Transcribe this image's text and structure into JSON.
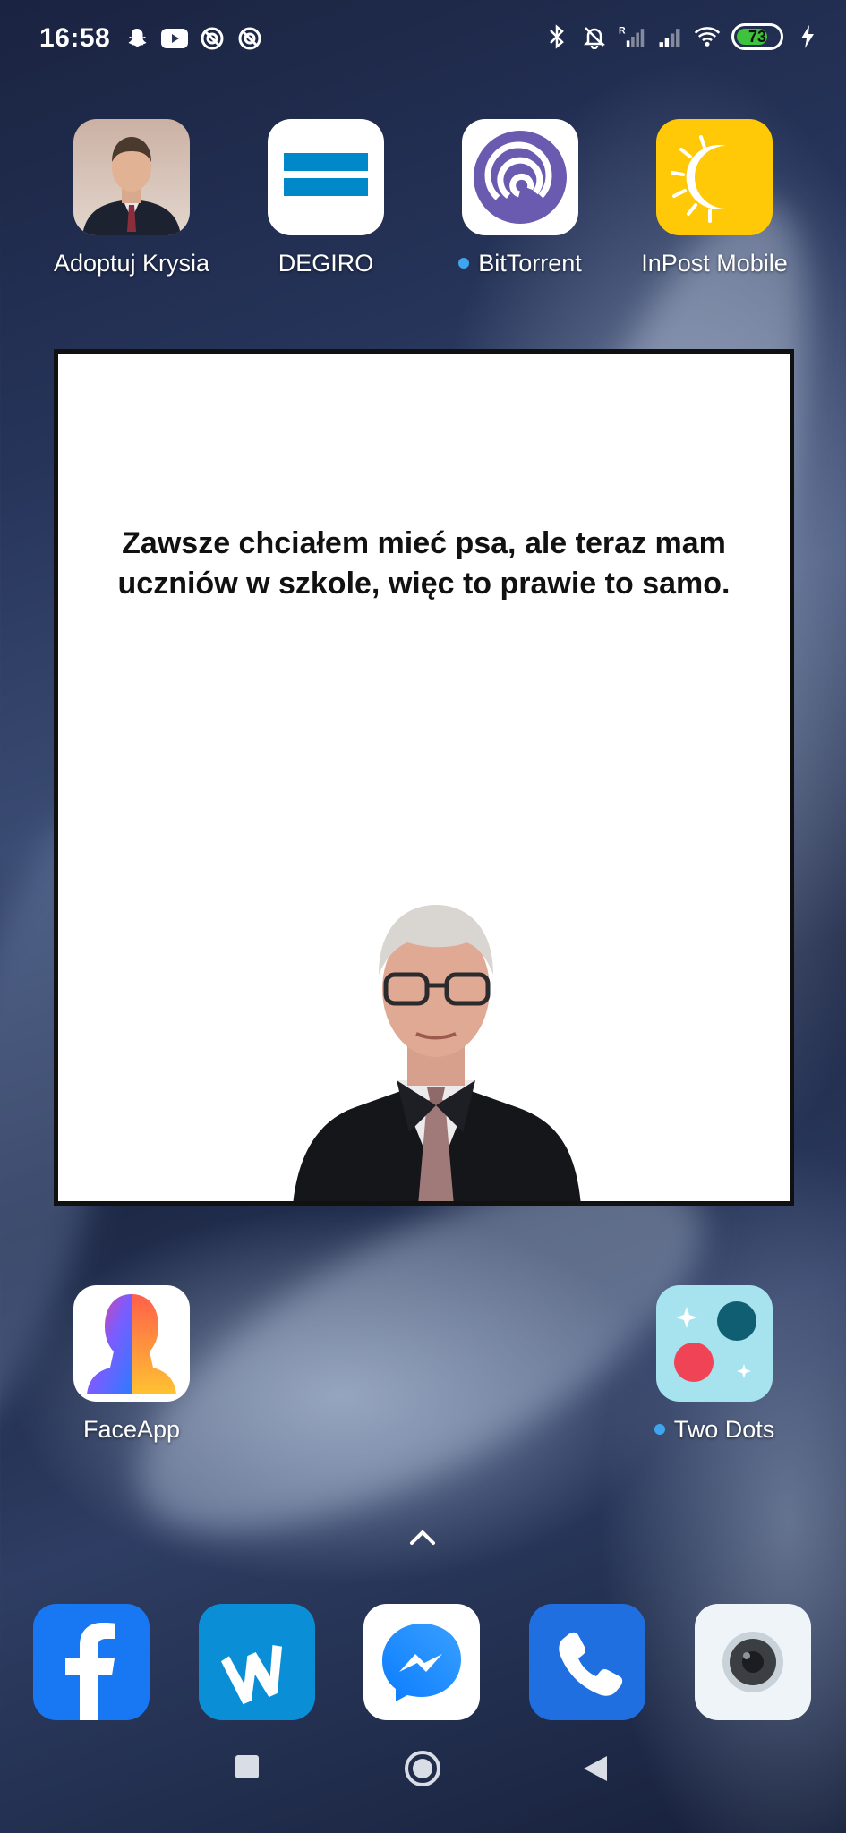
{
  "status_bar": {
    "time": "16:58",
    "battery_level": "73",
    "battery_percent": 73,
    "left_icons": [
      "snapchat-icon",
      "youtube-icon",
      "blocked-app-icon",
      "blocked-app-icon"
    ],
    "right_icons": [
      "bluetooth-icon",
      "muted-bell-icon",
      "signal-roaming-icon",
      "signal-icon",
      "wifi-icon",
      "battery-icon",
      "charging-icon"
    ]
  },
  "home": {
    "top_row": [
      {
        "label": "Adoptuj Krysia",
        "icon": "portrait-man-icon",
        "new_dot": false
      },
      {
        "label": "DEGIRO",
        "icon": "degiro-logo-icon",
        "new_dot": false
      },
      {
        "label": "BitTorrent",
        "icon": "bittorrent-logo-icon",
        "new_dot": true
      },
      {
        "label": "InPost Mobile",
        "icon": "inpost-sun-icon",
        "new_dot": false
      }
    ],
    "widget": {
      "quote": "Zawsze chciałem mieć psa, ale teraz mam uczniów w szkole, więc to prawie to samo."
    },
    "bottom_row": [
      {
        "label": "FaceApp",
        "icon": "faceapp-face-icon",
        "new_dot": false
      },
      {
        "label": "Two Dots",
        "icon": "two-dots-icon",
        "new_dot": true
      }
    ]
  },
  "dock": [
    "facebook-icon",
    "wattpad-icon",
    "messenger-icon",
    "phone-icon",
    "camera-icon"
  ],
  "nav": [
    "recents-square-icon",
    "home-circle-icon",
    "back-triangle-icon"
  ],
  "colors": {
    "dot_accent": "#3ea6f0",
    "battery_green": "#3fc23d",
    "facebook_blue": "#1877f2",
    "inpost_yellow": "#ffc907",
    "degiro_blue": "#0088c8"
  }
}
